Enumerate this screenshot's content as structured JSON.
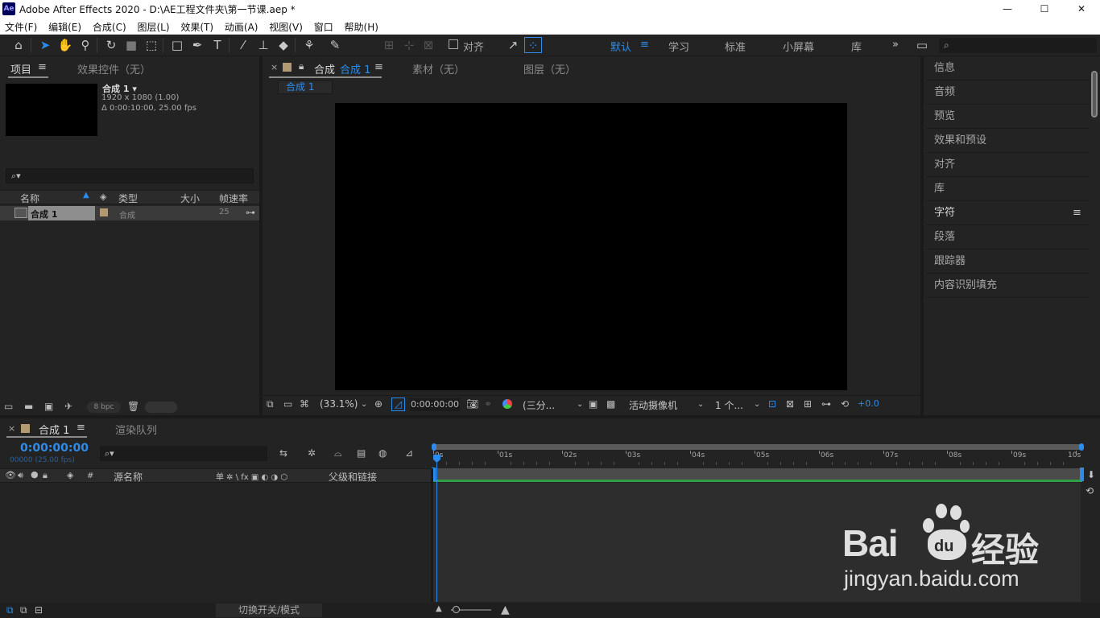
{
  "window": {
    "app_icon": "Ae",
    "title": "Adobe After Effects 2020 - D:\\AE工程文件夹\\第一节课.aep *",
    "minimize": "—",
    "maximize": "☐",
    "close": "✕"
  },
  "menu": [
    "文件(F)",
    "编辑(E)",
    "合成(C)",
    "图层(L)",
    "效果(T)",
    "动画(A)",
    "视图(V)",
    "窗口",
    "帮助(H)"
  ],
  "toolbar": {
    "align_label": "对齐",
    "workspaces": [
      "默认",
      "学习",
      "标准",
      "小屏幕",
      "库"
    ],
    "active_workspace": "默认",
    "more": "»",
    "search_placeholder": "⌕"
  },
  "project_panel": {
    "tab_project": "项目",
    "tab_effects": "效果控件（无）",
    "comp_name": "合成 1 ▾",
    "comp_size": "1920 x 1080 (1.00)",
    "comp_duration": "Δ 0:00:10:00, 25.00 fps",
    "search_placeholder": "⌕▾",
    "columns": {
      "name": "名称",
      "type": "类型",
      "size": "大小",
      "fps": "帧速率"
    },
    "items": [
      {
        "name": "合成 1",
        "type": "合成",
        "size": "",
        "fps": "25"
      }
    ],
    "bpc": "8 bpc"
  },
  "comp_panel": {
    "tab_comp_prefix": "合成",
    "tab_comp_name": "合成 1",
    "tab_footage": "素材（无）",
    "tab_layer": "图层（无）",
    "breadcrumb": "合成 1",
    "zoom": "(33.1%)",
    "timecode": "0:00:00:00",
    "resolution": "(三分...",
    "camera": "活动摄像机",
    "views": "1 个...",
    "exposure": "+0.0"
  },
  "right_panel": {
    "items": [
      "信息",
      "音频",
      "预览",
      "效果和预设",
      "对齐",
      "库",
      "字符",
      "段落",
      "跟踪器",
      "内容识别填充"
    ]
  },
  "timeline": {
    "tab_comp": "合成 1",
    "tab_render": "渲染队列",
    "timecode": "0:00:00:00",
    "frame_info": "00000 (25.00 fps)",
    "search_placeholder": "⌕▾",
    "col_hash": "#",
    "col_source": "源名称",
    "col_switches": "单 ✲ \\ fx ▣ ◐ ◑ ⬡",
    "col_parent": "父级和链接",
    "ruler": [
      "0s",
      "01s",
      "02s",
      "03s",
      "04s",
      "05s",
      "06s",
      "07s",
      "08s",
      "09s",
      "10s"
    ],
    "toggle_label": "切换开关/模式"
  },
  "watermark": {
    "brand": "Bai",
    "brand2": "du",
    "brand3": "经验",
    "url": "jingyan.baidu.com"
  },
  "colors": {
    "accent": "#2d8ceb",
    "panel_bg": "#232323",
    "work_area": "#2ea043"
  }
}
